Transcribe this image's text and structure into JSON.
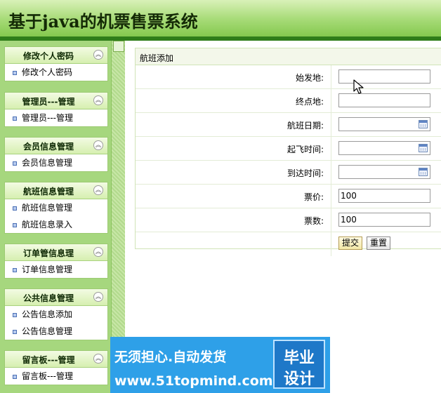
{
  "header": {
    "title": "基于java的机票售票系统"
  },
  "sidebar": {
    "panels": [
      {
        "title": "修改个人密码",
        "items": [
          "修改个人密码"
        ]
      },
      {
        "title": "管理员---管理",
        "items": [
          "管理员---管理"
        ]
      },
      {
        "title": "会员信息管理",
        "items": [
          "会员信息管理"
        ]
      },
      {
        "title": "航班信息管理",
        "items": [
          "航班信息管理",
          "航班信息录入"
        ]
      },
      {
        "title": "订单管信息理",
        "items": [
          "订单信息管理"
        ]
      },
      {
        "title": "公共信息管理",
        "items": [
          "公告信息添加",
          "公告信息管理"
        ]
      },
      {
        "title": "留言板---管理",
        "items": [
          "留言板---管理"
        ]
      }
    ],
    "toggle_glyph": "︽"
  },
  "form": {
    "title": "航班添加",
    "fields": [
      {
        "label": "始发地:",
        "value": "",
        "has_calendar": false
      },
      {
        "label": "终点地:",
        "value": "",
        "has_calendar": false
      },
      {
        "label": "航班日期:",
        "value": "",
        "has_calendar": true
      },
      {
        "label": "起飞时间:",
        "value": "",
        "has_calendar": true
      },
      {
        "label": "到达时间:",
        "value": "",
        "has_calendar": true
      },
      {
        "label": "票价:",
        "value": "100",
        "has_calendar": false
      },
      {
        "label": "票数:",
        "value": "100",
        "has_calendar": false
      }
    ],
    "submit_label": "提交",
    "reset_label": "重置"
  },
  "banner": {
    "line1": "无须担心.自动发货",
    "line2": "www.51topmind.com",
    "badge_line1": "毕业",
    "badge_line2": "设计"
  },
  "colors": {
    "header_dark": "#2f7d1a",
    "sidebar_bg": "#a6d77e",
    "banner_blue": "#2ea0e8"
  }
}
